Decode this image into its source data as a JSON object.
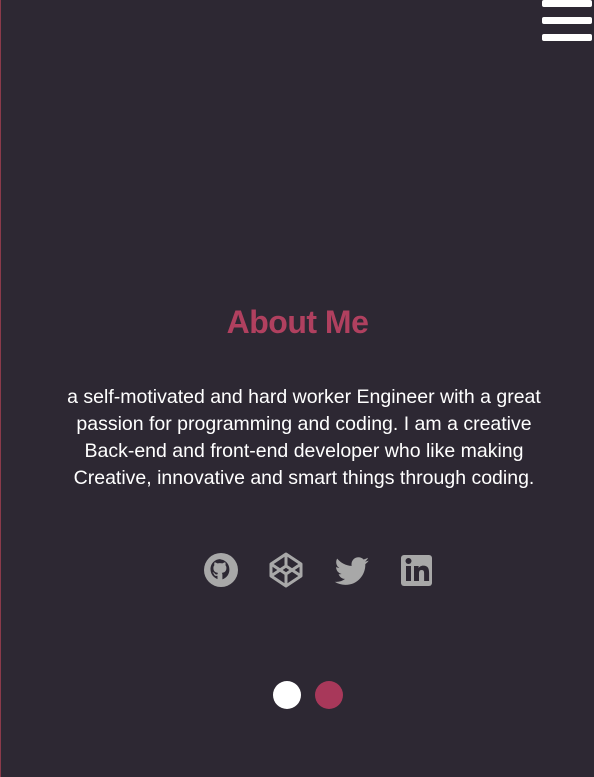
{
  "menu": {
    "icon": "hamburger-menu-icon"
  },
  "about": {
    "title": "About Me",
    "bio_lines": [
      "a self-motivated and hard worker Engineer with a great",
      "passion for programming and coding. I am a creative",
      "Back-end and front-end developer who like making",
      "Creative, innovative and smart things through coding."
    ]
  },
  "social": [
    {
      "icon": "github-icon"
    },
    {
      "icon": "codepen-icon"
    },
    {
      "icon": "twitter-icon"
    },
    {
      "icon": "linkedin-icon"
    }
  ],
  "carousel": {
    "dots": [
      {
        "state": "active",
        "color": "#ffffff"
      },
      {
        "state": "inactive",
        "color": "#a8385a"
      }
    ]
  },
  "colors": {
    "background": "#2d2833",
    "accent": "#b0405f",
    "text": "#ffffff",
    "icon": "#a8a8a8"
  }
}
